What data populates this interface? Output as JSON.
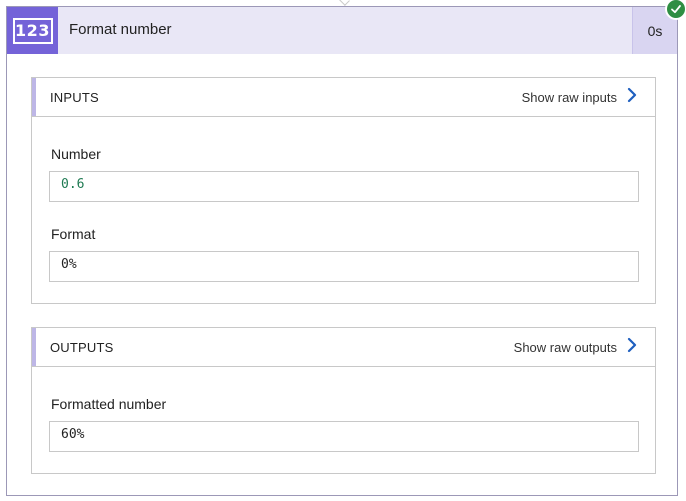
{
  "action": {
    "icon_text": "123",
    "icon_name": "number-format-icon",
    "title": "Format number",
    "duration": "0s",
    "status": "succeeded",
    "accent_color": "#7463d8",
    "header_bg": "#e9e7f6",
    "status_color": "#2f8e43"
  },
  "inputs": {
    "heading": "INPUTS",
    "raw_link": "Show raw inputs",
    "fields": [
      {
        "label": "Number",
        "value": "0.6"
      },
      {
        "label": "Format",
        "value": "0%"
      }
    ]
  },
  "outputs": {
    "heading": "OUTPUTS",
    "raw_link": "Show raw outputs",
    "fields": [
      {
        "label": "Formatted number",
        "value": "60%"
      }
    ]
  }
}
